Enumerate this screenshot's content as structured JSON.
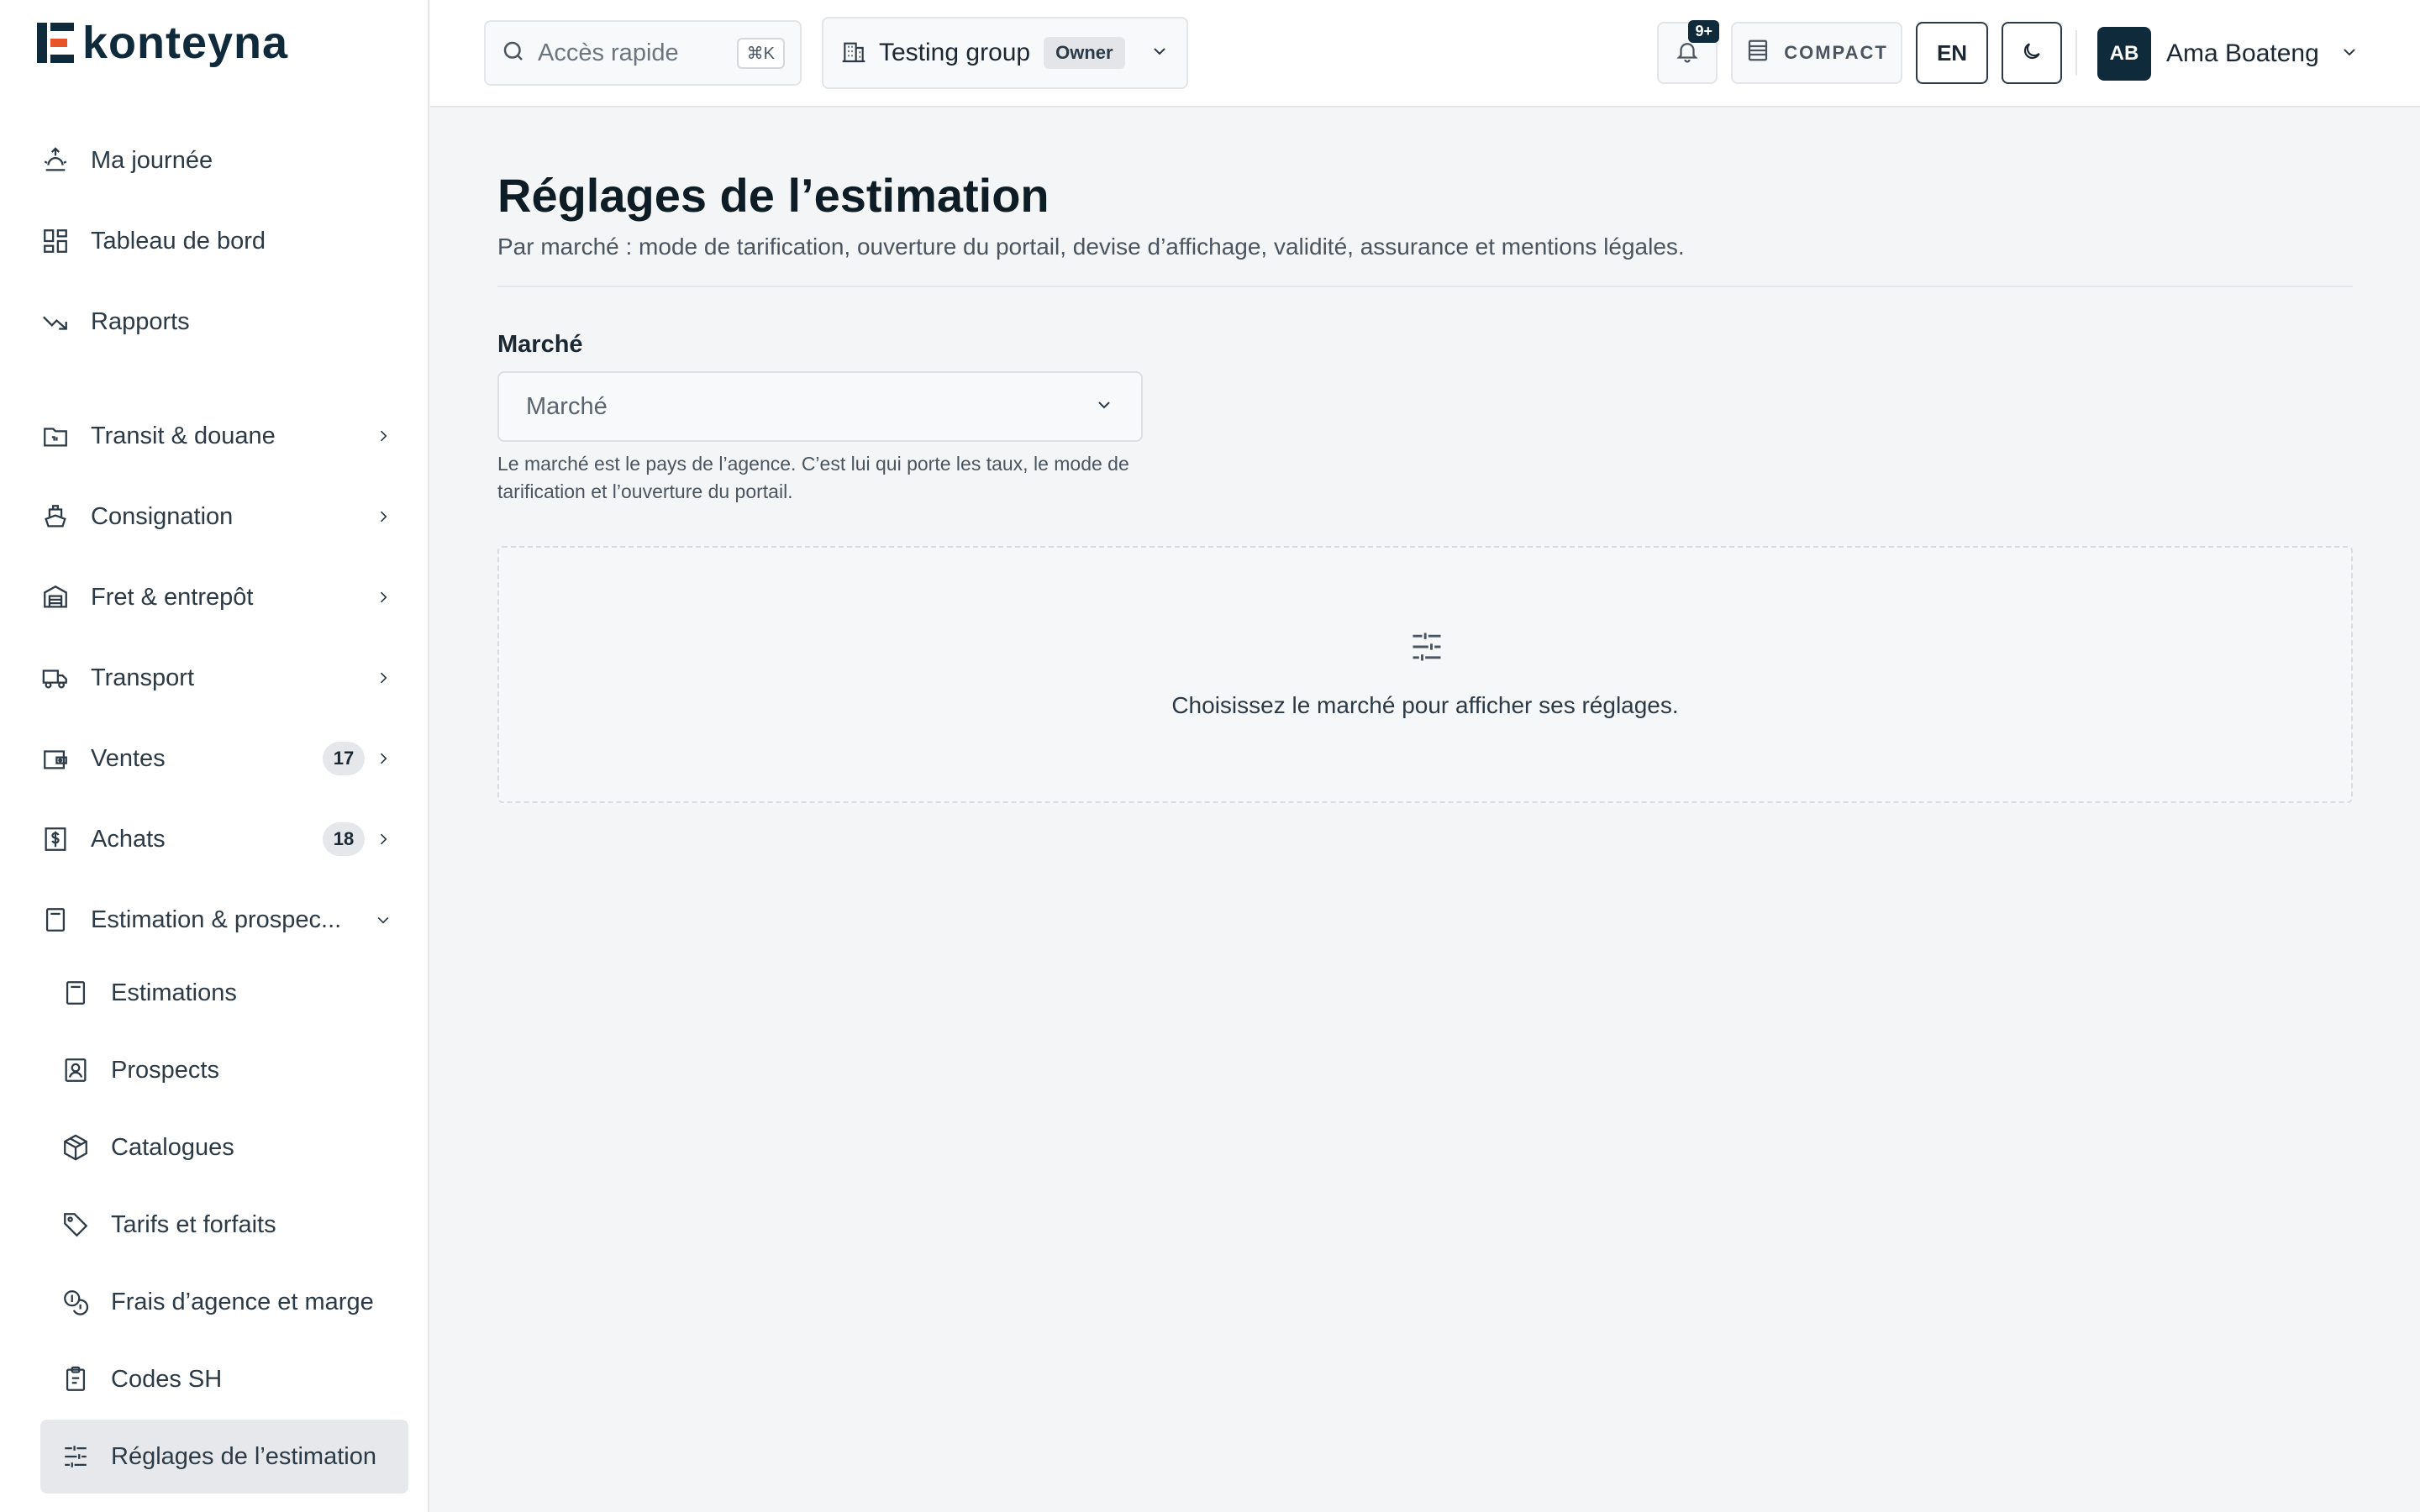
{
  "brand": {
    "name": "konteyna"
  },
  "sidebar": {
    "items": [
      {
        "label": "Ma journée",
        "icon": "sun-rise-icon"
      },
      {
        "label": "Tableau de bord",
        "icon": "dashboard-icon"
      },
      {
        "label": "Rapports",
        "icon": "trend-down-icon"
      },
      {
        "label": "Transit & douane",
        "icon": "folder-icon"
      },
      {
        "label": "Consignation",
        "icon": "ship-icon"
      },
      {
        "label": "Fret & entrepôt",
        "icon": "warehouse-icon"
      },
      {
        "label": "Transport",
        "icon": "truck-icon"
      },
      {
        "label": "Ventes",
        "icon": "wallet-icon",
        "badge": "17"
      },
      {
        "label": "Achats",
        "icon": "receipt-dollar-icon",
        "badge": "18"
      },
      {
        "label": "Estimation & prospec...",
        "icon": "calculator-icon"
      }
    ],
    "subitems": [
      {
        "label": "Estimations",
        "icon": "calculator-icon"
      },
      {
        "label": "Prospects",
        "icon": "contact-icon"
      },
      {
        "label": "Catalogues",
        "icon": "package-icon"
      },
      {
        "label": "Tarifs et forfaits",
        "icon": "tag-icon"
      },
      {
        "label": "Frais d’agence et marge",
        "icon": "coins-icon"
      },
      {
        "label": "Codes SH",
        "icon": "clipboard-icon"
      },
      {
        "label": "Réglages de l’estimation",
        "icon": "sliders-icon"
      }
    ]
  },
  "topbar": {
    "search_placeholder": "Accès rapide",
    "search_shortcut": "⌘K",
    "group_name": "Testing group",
    "group_role": "Owner",
    "notifications_count": "9+",
    "compact_label": "COMPACT",
    "language": "EN",
    "user_initials": "AB",
    "user_name": "Ama Boateng"
  },
  "page": {
    "title": "Réglages de l’estimation",
    "subtitle": "Par marché : mode de tarification, ouverture du portail, devise d’affichage, validité, assurance et mentions légales.",
    "field_label": "Marché",
    "select_value": "Marché",
    "help_text": "Le marché est le pays de l’agence. C’est lui qui porte les taux, le mode de tarification et l’ouverture du portail.",
    "empty_message": "Choisissez le marché pour afficher ses réglages."
  },
  "colors": {
    "brand_dark": "#0f2a3a",
    "active_bg": "#e7e8eb",
    "page_bg": "#f4f5f7"
  }
}
